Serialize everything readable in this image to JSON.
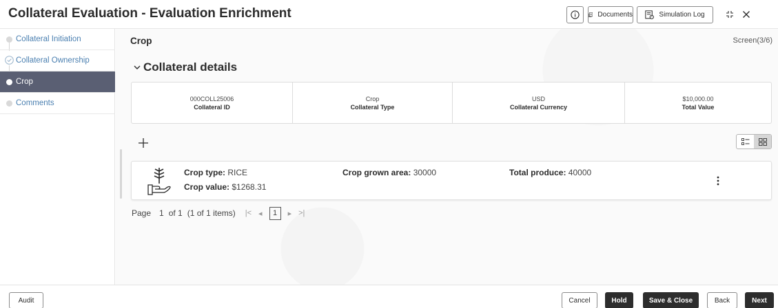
{
  "header": {
    "title": "Collateral Evaluation - Evaluation Enrichment",
    "info_icon": "info-icon",
    "documents_label": "Documents",
    "simulation_log_label": "Simulation Log"
  },
  "sidebar": {
    "steps": [
      {
        "label": "Collateral Initiation",
        "state": "pending"
      },
      {
        "label": "Collateral Ownership",
        "state": "completed"
      },
      {
        "label": "Crop",
        "state": "active"
      },
      {
        "label": "Comments",
        "state": "pending"
      }
    ]
  },
  "main": {
    "section_title": "Crop",
    "screen_indicator": "Screen(3/6)",
    "collateral_details": {
      "title": "Collateral details",
      "items": [
        {
          "value": "000COLL25006",
          "label": "Collateral ID"
        },
        {
          "value": "Crop",
          "label": "Collateral Type"
        },
        {
          "value": "USD",
          "label": "Collateral Currency"
        },
        {
          "value": "$10,000.00",
          "label": "Total Value"
        }
      ]
    },
    "crop_record": {
      "crop_type_label": "Crop type:",
      "crop_type_value": "RICE",
      "crop_value_label": "Crop value:",
      "crop_value_value": "$1268.31",
      "grown_area_label": "Crop grown area:",
      "grown_area_value": "30000",
      "total_produce_label": "Total produce:",
      "total_produce_value": "40000"
    },
    "pagination": {
      "page_label": "Page",
      "page_number": "1",
      "of_label": "of 1",
      "items_label": "(1 of 1 items)",
      "current_page": "1"
    }
  },
  "footer": {
    "audit_label": "Audit",
    "cancel_label": "Cancel",
    "hold_label": "Hold",
    "save_close_label": "Save & Close",
    "back_label": "Back",
    "next_label": "Next"
  },
  "colors": {
    "active_step_bg": "#5a5f73",
    "link_blue": "#4a7fb0",
    "dark_button": "#2d2d2d"
  }
}
